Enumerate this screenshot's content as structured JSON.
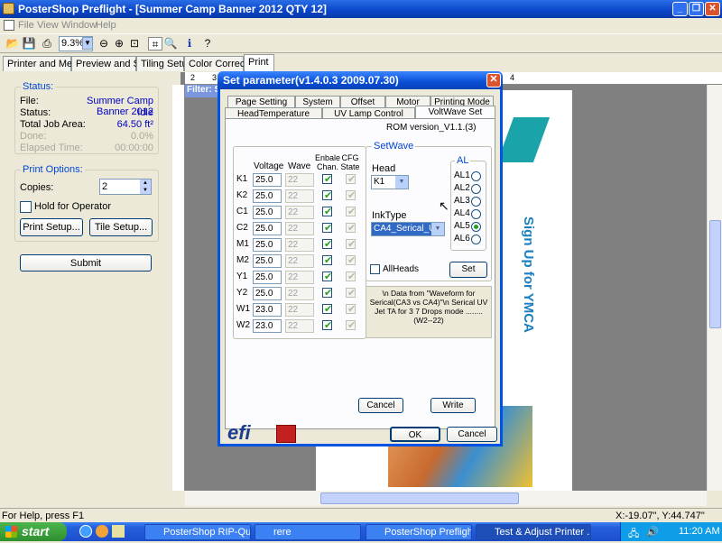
{
  "app": {
    "title": "PosterShop Preflight - [Summer Camp Banner 2012 QTY 12]",
    "window_buttons": [
      "_",
      "❐",
      "✕"
    ]
  },
  "menu": [
    "File",
    "View",
    "Window",
    "Help"
  ],
  "toolbar": {
    "zoom_value": "9.3%"
  },
  "tabs": [
    "Printer and Media",
    "Preview and Size",
    "Tiling Setup",
    "Color Correction",
    "Print"
  ],
  "status": {
    "group_label": "Status:",
    "rows": [
      {
        "label": "File:",
        "value": "Summer Camp Banner 2012"
      },
      {
        "label": "Status:",
        "value": "Idle"
      },
      {
        "label": "Total Job Area:",
        "value": "64.50 ft²"
      },
      {
        "label": "Done:",
        "value": "0.0%"
      },
      {
        "label": "Elapsed Time:",
        "value": "00:00:00"
      }
    ]
  },
  "print_options": {
    "group_label": "Print Options:",
    "copies_label": "Copies:",
    "copies_value": "2",
    "hold_label": "Hold for Operator",
    "print_setup": "Print Setup...",
    "tile_setup": "Tile Setup..."
  },
  "submit_label": "Submit",
  "canvas": {
    "filter_label": "Filter: S",
    "ruler_marks": [
      "2",
      "3",
      "4"
    ],
    "banner_text": "Sign Up for YMCA"
  },
  "dialog": {
    "title": "Set parameter(v1.4.0.3 2009.07.30)",
    "tabs_row1": [
      "Page Setting",
      "System",
      "Offset",
      "Motor",
      "Printing Mode"
    ],
    "tabs_row2": [
      "HeadTemperature",
      "UV Lamp Control",
      "VoltWave Set"
    ],
    "rom_version": "ROM version_V1.1.(3)",
    "table_headers": [
      "Voltage",
      "Wave",
      "Enbale Chan.",
      "CFG State"
    ],
    "channels": [
      {
        "name": "K1",
        "voltage": "25.0",
        "wave": "22"
      },
      {
        "name": "K2",
        "voltage": "25.0",
        "wave": "22"
      },
      {
        "name": "C1",
        "voltage": "25.0",
        "wave": "22"
      },
      {
        "name": "C2",
        "voltage": "25.0",
        "wave": "22"
      },
      {
        "name": "M1",
        "voltage": "25.0",
        "wave": "22"
      },
      {
        "name": "M2",
        "voltage": "25.0",
        "wave": "22"
      },
      {
        "name": "Y1",
        "voltage": "25.0",
        "wave": "22"
      },
      {
        "name": "Y2",
        "voltage": "25.0",
        "wave": "22"
      },
      {
        "name": "W1",
        "voltage": "23.0",
        "wave": "22"
      },
      {
        "name": "W2",
        "voltage": "23.0",
        "wave": "22"
      }
    ],
    "setwave": {
      "group_label": "SetWave",
      "head_label": "Head",
      "head_value": "K1",
      "al_label": "AL",
      "al_options": [
        "AL1",
        "AL2",
        "AL3",
        "AL4",
        "AL5",
        "AL6"
      ],
      "al_selected": "AL5",
      "inktype_label": "InkType",
      "inktype_value": "CA4_Serical_UV",
      "allheads_label": "AllHeads",
      "set_button": "Set"
    },
    "note": "\\n Data from \"Waveform for Serical(CA3 vs CA4)\"\\n Serical UV Jet TA for 3  7 Drops mode ........(W2--22)",
    "cancel_inner": "Cancel",
    "write": "Write",
    "ok": "OK",
    "cancel": "Cancel",
    "logo": "efi"
  },
  "statusbar": {
    "help": "For Help, press F1",
    "coords": "X:-19.07\", Y:44.747\""
  },
  "taskbar": {
    "start": "start",
    "items": [
      "PosterShop RIP-Queue",
      "rere",
      "PosterShop Preflight ...",
      "Test & Adjust Printer ..."
    ],
    "clock": "11:20 AM"
  }
}
